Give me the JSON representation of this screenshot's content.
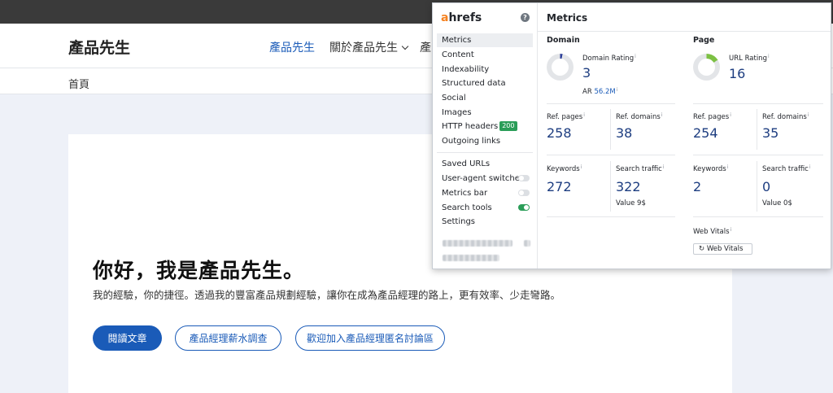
{
  "site": {
    "title": "產品先生",
    "nav": [
      "產品先生",
      "關於產品先生",
      "產"
    ],
    "breadcrumb": "首頁"
  },
  "hero": {
    "title": "你好，我是產品先生。",
    "description": "我的經驗，你的捷徑。透過我的豐富產品規劃經驗，讓你在成為產品經理的路上，更有效率、少走彎路。",
    "buttons": [
      "閱讀文章",
      "產品經理薪水調查",
      "歡迎加入產品經理匿名討論區"
    ]
  },
  "ahrefs": {
    "logo_accent": "a",
    "logo_rest": "hrefs",
    "title": "Metrics",
    "menu": [
      "Metrics",
      "Content",
      "Indexability",
      "Structured data",
      "Social",
      "Images",
      "HTTP headers",
      "Outgoing links"
    ],
    "http_badge": "200",
    "tools": [
      "Saved URLs",
      "User-agent switcher",
      "Metrics bar",
      "Search tools",
      "Settings"
    ],
    "toggles": {
      "user_agent_switcher": false,
      "metrics_bar": false,
      "search_tools": true
    },
    "domain": {
      "heading": "Domain",
      "rating_label": "Domain Rating",
      "rating_value": "3",
      "ar_label": "AR",
      "ar_value": "56.2M",
      "ref_pages_label": "Ref. pages",
      "ref_pages": "258",
      "ref_domains_label": "Ref. domains",
      "ref_domains": "38",
      "keywords_label": "Keywords",
      "keywords": "272",
      "search_traffic_label": "Search traffic",
      "search_traffic": "322",
      "value_label": "Value 9$"
    },
    "page": {
      "heading": "Page",
      "rating_label": "URL Rating",
      "rating_value": "16",
      "ref_pages_label": "Ref. pages",
      "ref_pages": "254",
      "ref_domains_label": "Ref. domains",
      "ref_domains": "35",
      "keywords_label": "Keywords",
      "keywords": "2",
      "search_traffic_label": "Search traffic",
      "search_traffic": "0",
      "value_label": "Value 0$",
      "web_vitals_label": "Web Vitals",
      "web_vitals_button": "Web Vitals"
    }
  },
  "colors": {
    "brand_blue": "#1a5bb8",
    "ahrefs_orange": "#f58220",
    "toggle_on": "#2a9d58",
    "dr_fill": "#2d3f99",
    "ur_fill": "#7cc043"
  }
}
